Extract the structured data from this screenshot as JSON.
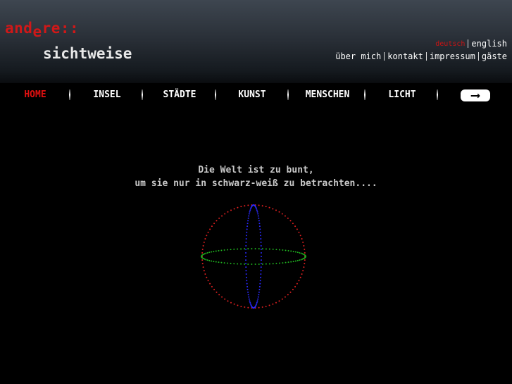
{
  "logo": {
    "top_part1": "and",
    "top_sub": "e",
    "top_part2": "re::",
    "bottom": "sichtweise"
  },
  "languages": {
    "active": "deutsch",
    "other": "english"
  },
  "top_links": [
    "über mich",
    "kontakt",
    "impressum",
    "gäste"
  ],
  "nav": {
    "items": [
      "HOME",
      "INSEL",
      "STÄDTE",
      "KUNST",
      "MENSCHEN",
      "LICHT"
    ],
    "active": "HOME",
    "next_icon": "right-arrow-icon",
    "next_glyph": "⟶"
  },
  "quote": {
    "line1": "Die Welt ist zu bunt,",
    "line2": "um sie nur in schwarz-weiß zu betrachten...."
  },
  "colors": {
    "accent": "#d01818",
    "globe_red": "#e02020",
    "globe_green": "#1fb01f",
    "globe_blue": "#2a2aff"
  }
}
